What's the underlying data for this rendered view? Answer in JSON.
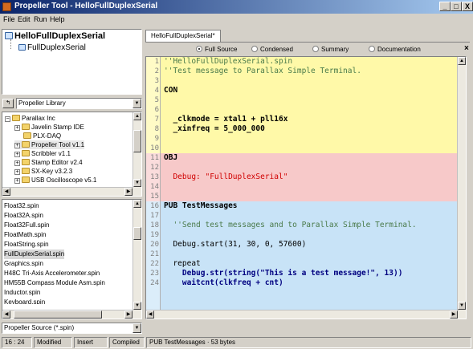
{
  "window": {
    "title": "Propeller Tool - HelloFullDuplexSerial",
    "minimize": "_",
    "maximize": "□",
    "close": "X"
  },
  "menu": [
    "File",
    "Edit",
    "Run",
    "Help"
  ],
  "object_tree": {
    "root": "HelloFullDuplexSerial",
    "child": "FullDuplexSerial"
  },
  "library": {
    "selector": "Propeller Library",
    "folders": [
      {
        "label": "Parallax Inc",
        "expander": "−"
      },
      {
        "label": "Javelin Stamp IDE",
        "expander": "+"
      },
      {
        "label": "PLX-DAQ",
        "expander": ""
      },
      {
        "label": "Propeller Tool v1.1",
        "expander": "+"
      },
      {
        "label": "Scribbler v1.1",
        "expander": "+"
      },
      {
        "label": "Stamp Editor v2.4",
        "expander": "+"
      },
      {
        "label": "SX-Key v3.2.3",
        "expander": "+"
      },
      {
        "label": "USB Oscilloscope v5.1",
        "expander": "+"
      }
    ],
    "files": [
      "Float32.spin",
      "Float32A.spin",
      "Float32Full.spin",
      "FloatMath.spin",
      "FloatString.spin",
      "FullDuplexSerial.spin",
      "Graphics.spin",
      "H48C Tri-Axis Accelerometer.spin",
      "HM55B Compass Module Asm.spin",
      "Inductor.spin",
      "Keyboard.spin"
    ],
    "selected_file": "FullDuplexSerial.spin",
    "filter": "Propeller Source (*.spin)"
  },
  "editor": {
    "tab": "HelloFullDuplexSerial*",
    "views": [
      "Full Source",
      "Condensed",
      "Summary",
      "Documentation"
    ],
    "active_view": "Full Source",
    "close": "×",
    "lines": [
      {
        "n": "1",
        "text": "''HelloFullDuplexSerial.spin"
      },
      {
        "n": "2",
        "text": "''Test message to Parallax Simple Terminal."
      },
      {
        "n": "3",
        "text": ""
      },
      {
        "n": "4",
        "text": "CON"
      },
      {
        "n": "5",
        "text": ""
      },
      {
        "n": "6",
        "text": ""
      },
      {
        "n": "7",
        "text": "  _clkmode = xtal1 + pll16x"
      },
      {
        "n": "8",
        "text": "  _xinfreq = 5_000_000"
      },
      {
        "n": "9",
        "text": ""
      },
      {
        "n": "10",
        "text": ""
      },
      {
        "n": "11",
        "text": "OBJ"
      },
      {
        "n": "12",
        "text": ""
      },
      {
        "n": "13",
        "text": "  Debug: \"FullDuplexSerial\""
      },
      {
        "n": "14",
        "text": ""
      },
      {
        "n": "15",
        "text": ""
      },
      {
        "n": "16",
        "text": "PUB TestMessages"
      },
      {
        "n": "17",
        "text": ""
      },
      {
        "n": "18",
        "text": "  ''Send test messages and to Parallax Simple Terminal."
      },
      {
        "n": "19",
        "text": ""
      },
      {
        "n": "20",
        "text": "  Debug.start(31, 30, 0, 57600)"
      },
      {
        "n": "21",
        "text": ""
      },
      {
        "n": "22",
        "text": "  repeat"
      },
      {
        "n": "23",
        "text": "    Debug.str(string(\"This is a test message!\", 13))"
      },
      {
        "n": "24",
        "text": "    waitcnt(clkfreq + cnt)"
      }
    ]
  },
  "status": {
    "position": "16 : 24",
    "modified": "Modified",
    "mode": "Insert",
    "compiled": "Compiled",
    "info": "PUB TestMessages  ·  53 bytes"
  },
  "colors": {
    "con_section": "#fff9a8",
    "obj_section": "#f7c9c9",
    "pub_section": "#c8e3f7",
    "titlebar": "#0a246a"
  }
}
